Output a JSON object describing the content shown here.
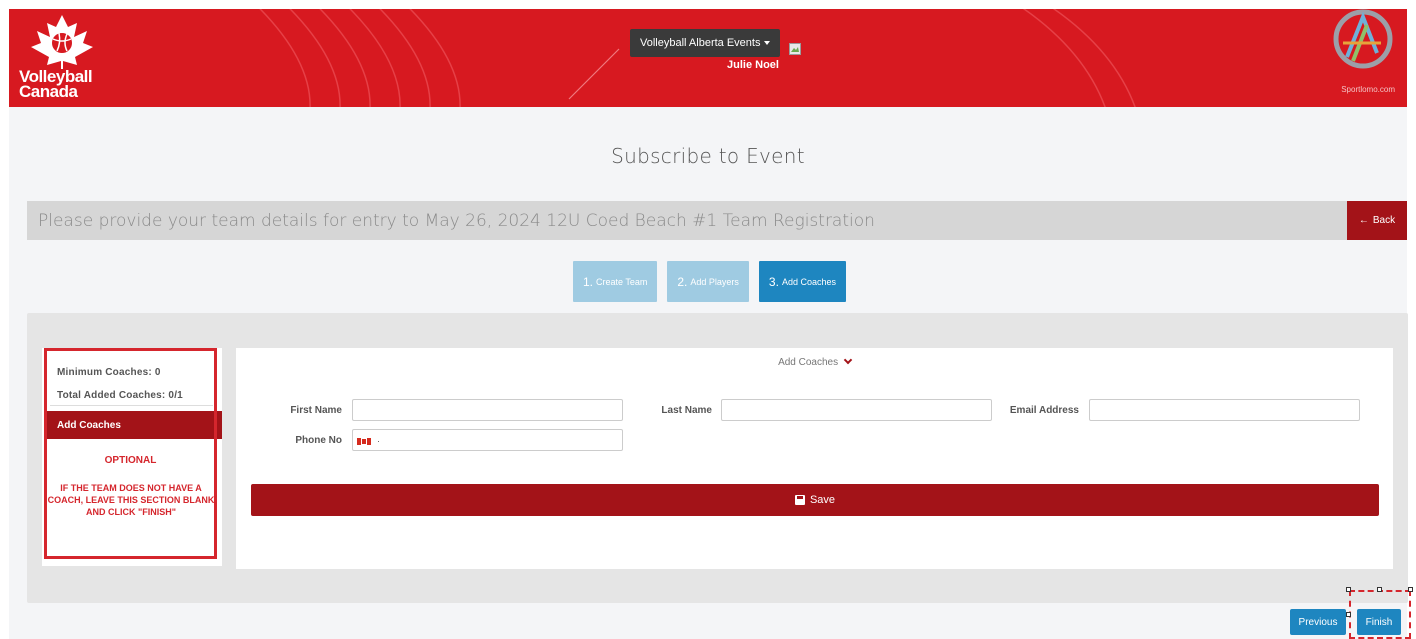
{
  "header": {
    "org_name_line1": "Volleyball",
    "org_name_line2": "Canada",
    "events_dropdown_label": "Volleyball Alberta Events",
    "user_name": "Julie Noel",
    "platform_name": "Sportlomo.com"
  },
  "page": {
    "title": "Subscribe to Event",
    "details_text": "Please provide your team details for entry to May 26, 2024 12U Coed Beach #1 Team Registration",
    "back_label": "Back"
  },
  "steps": [
    {
      "num": "1.",
      "label": "Create Team",
      "state": "done"
    },
    {
      "num": "2.",
      "label": "Add Players",
      "state": "done"
    },
    {
      "num": "3.",
      "label": "Add Coaches",
      "state": "active"
    }
  ],
  "sidebar": {
    "minimum": "Minimum Coaches: 0",
    "total": "Total Added Coaches: 0/1",
    "active_item": "Add Coaches",
    "optional": "OPTIONAL",
    "note": "IF THE TEAM DOES NOT HAVE A COACH, LEAVE THIS SECTION BLANK AND CLICK \"FINISH\""
  },
  "form": {
    "heading": "Add Coaches",
    "first_name_label": "First Name",
    "first_name_value": "",
    "last_name_label": "Last Name",
    "last_name_value": "",
    "email_label": "Email Address",
    "email_value": "",
    "phone_label": "Phone No",
    "phone_dot": "·",
    "save_label": "Save"
  },
  "footer": {
    "previous_label": "Previous",
    "finish_label": "Finish"
  },
  "colors": {
    "brand_red": "#d71920",
    "dark_red": "#a31318",
    "step_active": "#1e86c0",
    "step_done": "#9fcbe2",
    "highlight": "#d5262d"
  },
  "icons": {
    "logo": "maple-leaf-volleyball-icon",
    "platform_logo": "sportlomo-logo-icon",
    "back": "arrow-left-icon",
    "chevron": "chevron-down-icon",
    "save": "floppy-disk-icon",
    "flag": "canada-flag-icon"
  }
}
